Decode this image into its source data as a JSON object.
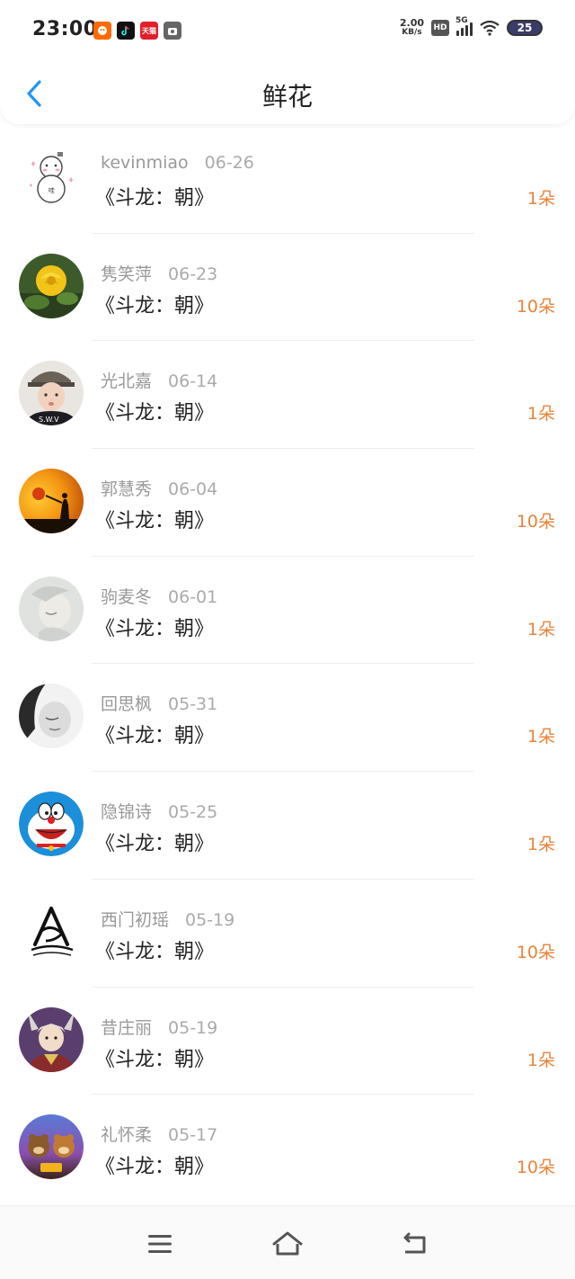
{
  "status_bar": {
    "time": "23:00",
    "net_speed_value": "2.00",
    "net_speed_unit": "KB/s",
    "hd": "HD",
    "network": "5G",
    "battery": "25",
    "app_icons": [
      "taobao-app-icon",
      "douyin-app-icon",
      "tmall-app-icon",
      "camera-app-icon"
    ],
    "tmall_label": "天猫"
  },
  "header": {
    "title": "鲜花",
    "back_icon": "chevron-left-icon",
    "accent": "#2196f3"
  },
  "gifts": [
    {
      "user": "kevinmiao",
      "date": "06-26",
      "book": "《斗龙：朝》",
      "count": "1朵",
      "avatar": "snowman"
    },
    {
      "user": "隽笑萍",
      "date": "06-23",
      "book": "《斗龙：朝》",
      "count": "10朵",
      "avatar": "yellow-rose"
    },
    {
      "user": "光北嘉",
      "date": "06-14",
      "book": "《斗龙：朝》",
      "count": "1朵",
      "avatar": "girl-cap"
    },
    {
      "user": "郭慧秀",
      "date": "06-04",
      "book": "《斗龙：朝》",
      "count": "10朵",
      "avatar": "sunset-silhouette"
    },
    {
      "user": "驹麦冬",
      "date": "06-01",
      "book": "《斗龙：朝》",
      "count": "1朵",
      "avatar": "pale-portrait"
    },
    {
      "user": "回思枫",
      "date": "05-31",
      "book": "《斗龙：朝》",
      "count": "1朵",
      "avatar": "bw-portrait"
    },
    {
      "user": "隐锦诗",
      "date": "05-25",
      "book": "《斗龙：朝》",
      "count": "1朵",
      "avatar": "doraemon"
    },
    {
      "user": "西门初瑶",
      "date": "05-19",
      "book": "《斗龙：朝》",
      "count": "10朵",
      "avatar": "ink-logo"
    },
    {
      "user": "昔庄丽",
      "date": "05-19",
      "book": "《斗龙：朝》",
      "count": "1朵",
      "avatar": "anime-character"
    },
    {
      "user": "礼怀柔",
      "date": "05-17",
      "book": "《斗龙：朝》",
      "count": "10朵",
      "avatar": "cartoon-bears"
    }
  ],
  "colors": {
    "count": "#e8833a",
    "meta": "#999999"
  },
  "bottom_nav": {
    "menu_icon": "menu-icon",
    "home_icon": "home-icon",
    "back_icon": "back-icon"
  }
}
